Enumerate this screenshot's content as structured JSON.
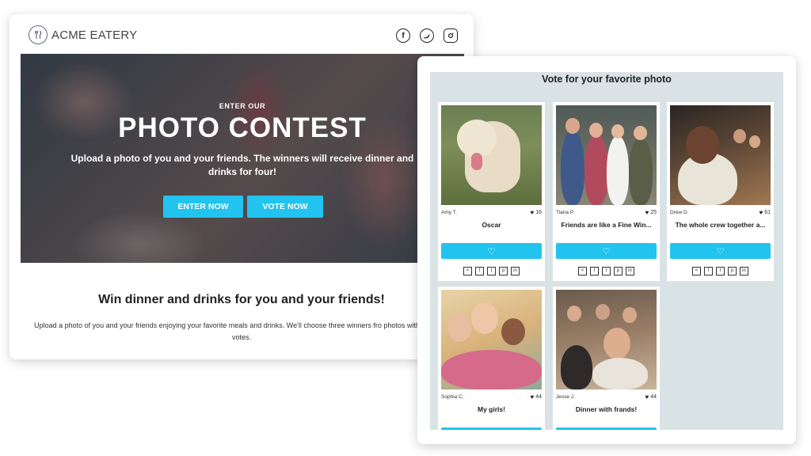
{
  "brand": {
    "name": "ACME EATERY",
    "logo": "fork-knife-logo-icon"
  },
  "socials": [
    {
      "icon": "facebook-icon",
      "glyph": "f"
    },
    {
      "icon": "twitter-icon",
      "glyph": "t"
    },
    {
      "icon": "instagram-icon",
      "glyph": "◎"
    }
  ],
  "hero": {
    "kicker": "ENTER OUR",
    "title": "PHOTO CONTEST",
    "subtitle": "Upload a photo of you and your friends. The winners will receive dinner and drinks for four!",
    "enter_label": "ENTER NOW",
    "vote_label": "VOTE NOW"
  },
  "section": {
    "title": "Win dinner and drinks for you and your friends!",
    "description": "Upload a photo of you and your friends enjoying your favorite meals and drinks. We'll choose three winners fro photos with the most votes."
  },
  "gallery": {
    "title": "Vote for your favorite photo",
    "entries": [
      {
        "author": "Amy T.",
        "votes": "16",
        "title": "Oscar"
      },
      {
        "author": "Tiana P.",
        "votes": "25",
        "title": "Friends are like a Fine Win..."
      },
      {
        "author": "Drew D.",
        "votes": "61",
        "title": "The whole crew together a..."
      },
      {
        "author": "Sophia C.",
        "votes": "44",
        "title": "My girls!"
      },
      {
        "author": "Jesse J.",
        "votes": "44",
        "title": "Dinner with frands!"
      }
    ],
    "share_icons": [
      "<",
      "f",
      "t",
      "p",
      "in"
    ]
  },
  "colors": {
    "accent": "#22c3ee",
    "gallery_bg": "#d9e3e6"
  }
}
